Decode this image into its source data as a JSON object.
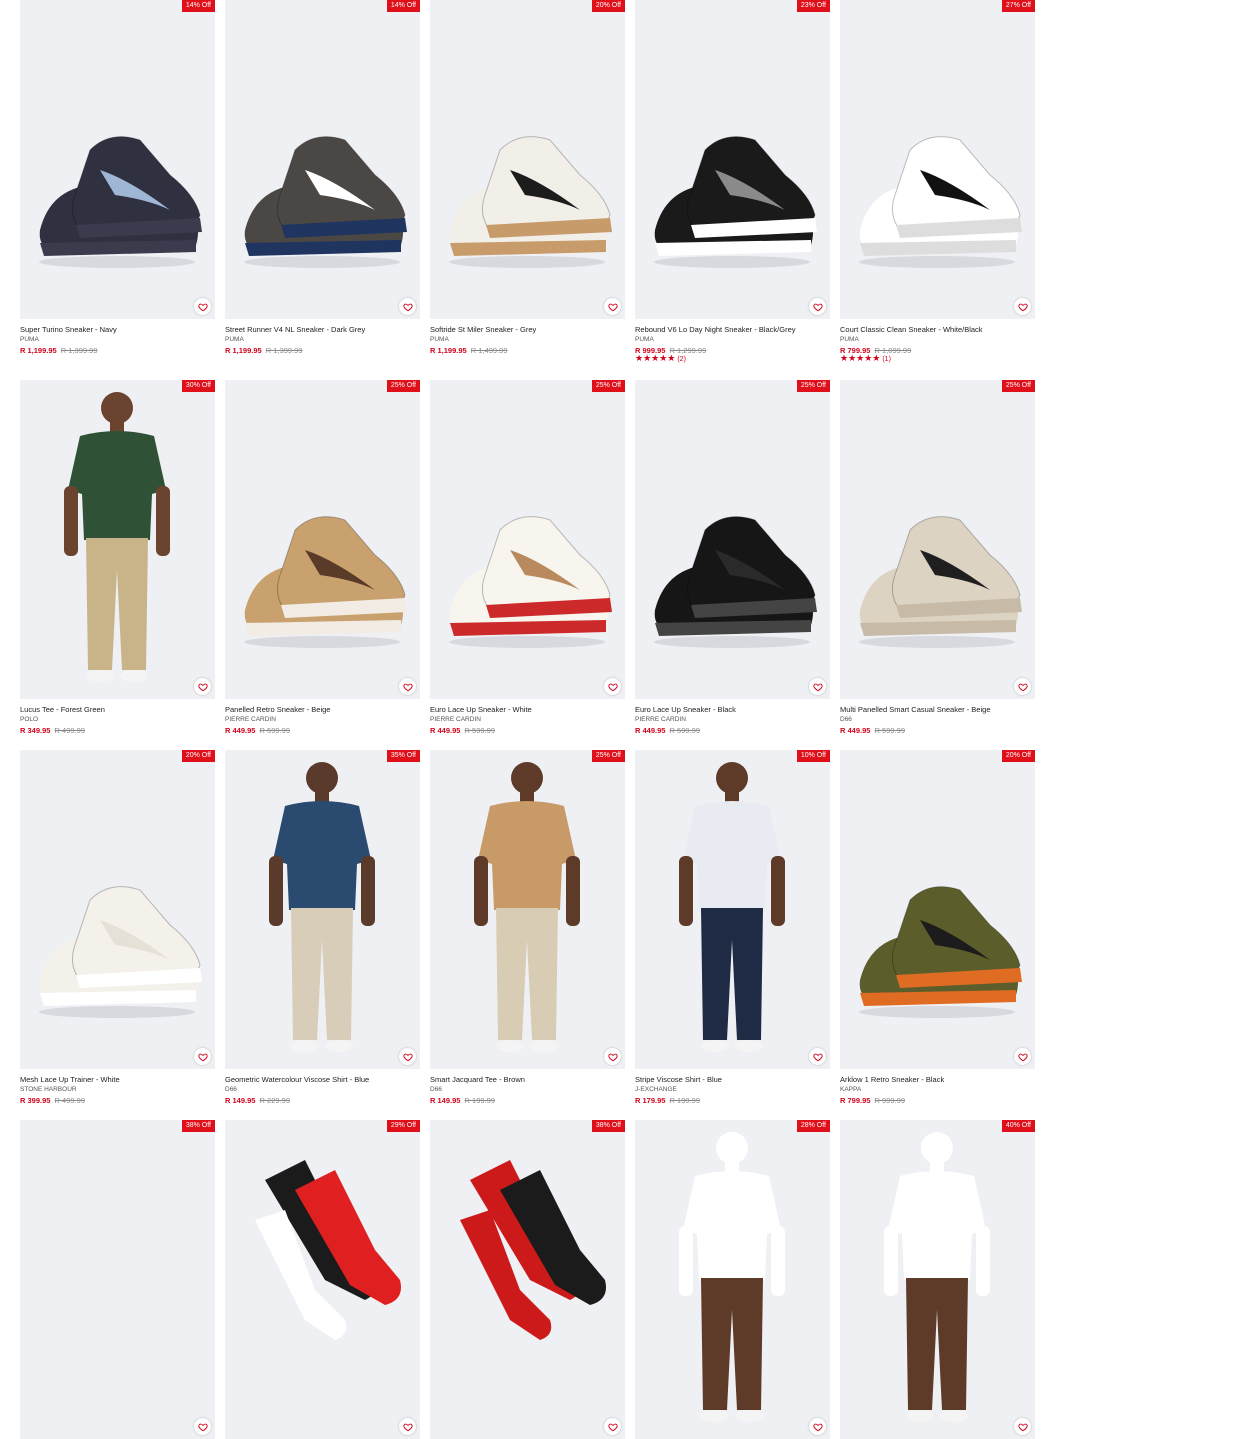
{
  "products": [
    {
      "name": "Super Turino Sneaker - Navy",
      "brand": "PUMA",
      "price": "R 1,199.95",
      "was": "R 1,399.99",
      "discount": "14% Off",
      "kind": "shoes",
      "colors": [
        "#2f3040",
        "#9fb7d4",
        "#3a3b4c"
      ]
    },
    {
      "name": "Street Runner V4 NL Sneaker - Dark Grey",
      "brand": "PUMA",
      "price": "R 1,199.95",
      "was": "R 1,399.99",
      "discount": "14% Off",
      "kind": "shoes",
      "colors": [
        "#4b4745",
        "#ffffff",
        "#1f3560"
      ]
    },
    {
      "name": "Softride St Miler Sneaker - Grey",
      "brand": "PUMA",
      "price": "R 1,199.95",
      "was": "R 1,499.99",
      "discount": "20% Off",
      "kind": "shoes",
      "colors": [
        "#f2efe8",
        "#1c1c1c",
        "#c79b6a"
      ]
    },
    {
      "name": "Rebound V6 Lo Day Night Sneaker - Black/Grey",
      "brand": "PUMA",
      "price": "R 999.95",
      "was": "R 1,299.99",
      "discount": "23% Off",
      "kind": "shoes",
      "colors": [
        "#1a1a1a",
        "#8a8a8a",
        "#ffffff"
      ],
      "stars": "★★★★★",
      "reviews": "(2)"
    },
    {
      "name": "Court Classic Clean Sneaker - White/Black",
      "brand": "PUMA",
      "price": "R 799.95",
      "was": "R 1,099.99",
      "discount": "27% Off",
      "kind": "shoes",
      "colors": [
        "#ffffff",
        "#111111",
        "#dddddd"
      ],
      "stars": "★★★★★",
      "reviews": "(1)"
    },
    {
      "name": "Lucus Tee - Forest Green",
      "brand": "POLO",
      "price": "R 349.95",
      "was": "R 499.99",
      "discount": "30% Off",
      "kind": "person",
      "colors": [
        "#2f5236",
        "#c9b48a",
        "#6b4430"
      ]
    },
    {
      "name": "Panelled Retro Sneaker - Beige",
      "brand": "PIERRE CARDIN",
      "price": "R 449.95",
      "was": "R 599.99",
      "discount": "25% Off",
      "kind": "shoes",
      "colors": [
        "#c8a16e",
        "#5a3b28",
        "#f3ece4"
      ]
    },
    {
      "name": "Euro Lace Up Sneaker - White",
      "brand": "PIERRE CARDIN",
      "price": "R 449.95",
      "was": "R 599.99",
      "discount": "25% Off",
      "kind": "shoes",
      "colors": [
        "#f7f5ee",
        "#b98a5e",
        "#cc2a2a"
      ]
    },
    {
      "name": "Euro Lace Up Sneaker - Black",
      "brand": "PIERRE CARDIN",
      "price": "R 449.95",
      "was": "R 599.99",
      "discount": "25% Off",
      "kind": "shoes",
      "colors": [
        "#161616",
        "#2a2a2a",
        "#444444"
      ]
    },
    {
      "name": "Multi Panelled Smart Casual Sneaker - Beige",
      "brand": "D66",
      "price": "R 449.95",
      "was": "R 599.99",
      "discount": "25% Off",
      "kind": "shoes",
      "colors": [
        "#ddd3c2",
        "#1f1f1f",
        "#c7bba8"
      ]
    },
    {
      "name": "Mesh Lace Up Trainer - White",
      "brand": "STONE HARBOUR",
      "price": "R 399.95",
      "was": "R 499.99",
      "discount": "20% Off",
      "kind": "shoes",
      "colors": [
        "#f4f1ea",
        "#e6e1d6",
        "#ffffff"
      ]
    },
    {
      "name": "Geometric Watercolour Viscose Shirt - Blue",
      "brand": "D66",
      "price": "R 149.95",
      "was": "R 229.99",
      "discount": "35% Off",
      "kind": "person",
      "colors": [
        "#2a4a70",
        "#d8cdb8",
        "#5a3b2b"
      ]
    },
    {
      "name": "Smart Jacquard Tee - Brown",
      "brand": "D66",
      "price": "R 149.95",
      "was": "R 199.99",
      "discount": "25% Off",
      "kind": "person",
      "colors": [
        "#c89a68",
        "#d9ccb4",
        "#5e3b28"
      ]
    },
    {
      "name": "Stripe Viscose Shirt - Blue",
      "brand": "J-EXCHANGE",
      "price": "R 179.95",
      "was": "R 199.99",
      "discount": "10% Off",
      "kind": "person",
      "colors": [
        "#e8ecf2",
        "#1f2a44",
        "#5e3b28"
      ]
    },
    {
      "name": "Arklow 1 Retro Sneaker - Black",
      "brand": "KAPPA",
      "price": "R 799.95",
      "was": "R 999.99",
      "discount": "20% Off",
      "kind": "shoes",
      "colors": [
        "#5b5d2a",
        "#1c1c1c",
        "#e06b22"
      ]
    },
    {
      "name": "",
      "brand": "",
      "price": "",
      "was": "",
      "discount": "38% Off",
      "kind": "blank",
      "colors": [
        "#eef0f4",
        "#eef0f4",
        "#eef0f4"
      ]
    },
    {
      "name": "",
      "brand": "",
      "price": "",
      "was": "",
      "discount": "29% Off",
      "kind": "socks",
      "colors": [
        "#1b1b1b",
        "#e02020",
        "#ffffff"
      ]
    },
    {
      "name": "",
      "brand": "",
      "price": "",
      "was": "",
      "discount": "38% Off",
      "kind": "socks",
      "colors": [
        "#cc1a1a",
        "#1b1b1b",
        "#cc1a1a"
      ]
    },
    {
      "name": "",
      "brand": "",
      "price": "",
      "was": "",
      "discount": "28% Off",
      "kind": "person",
      "colors": [
        "#ffffff",
        "#5e3b28",
        "#ffffff"
      ]
    },
    {
      "name": "",
      "brand": "",
      "price": "",
      "was": "",
      "discount": "40% Off",
      "kind": "person",
      "colors": [
        "#ffffff",
        "#5e3b28",
        "#ffffff"
      ]
    }
  ]
}
